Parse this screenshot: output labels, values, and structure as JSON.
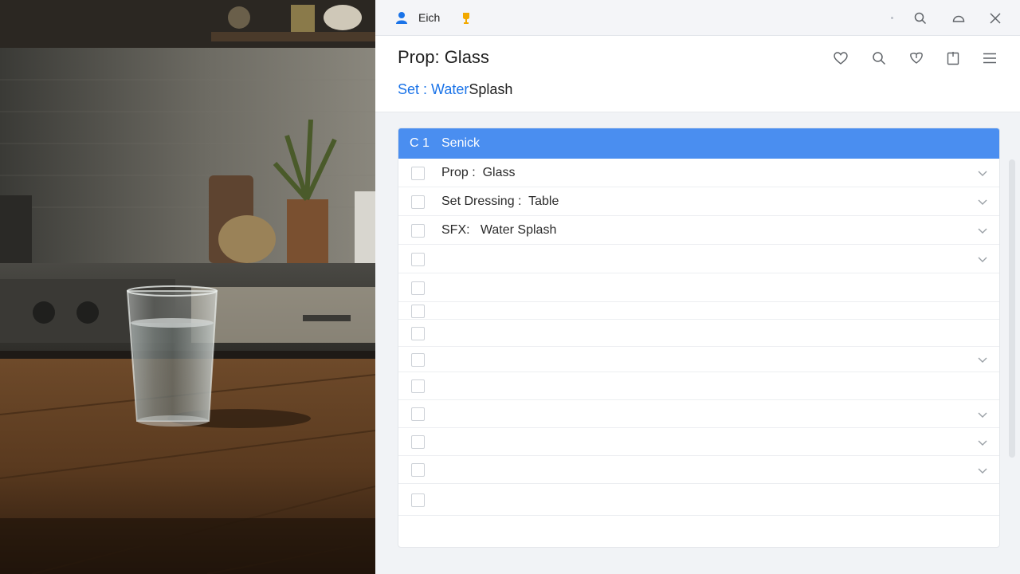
{
  "topbar": {
    "user_name": "Eich"
  },
  "header": {
    "title": "Prop: Glass",
    "subtitle_prefix": "Set :",
    "subtitle_mid": "Water",
    "subtitle_end": "Splash"
  },
  "list": {
    "header_code": "C 1",
    "header_label": "Senick",
    "rows": [
      {
        "label": "Prop :  Glass",
        "chevron": true
      },
      {
        "label": "Set Dressing :  Table",
        "chevron": true
      },
      {
        "label": "SFX:   Water Splash",
        "chevron": true
      },
      {
        "label": "",
        "chevron": true
      },
      {
        "label": "",
        "chevron": false
      },
      {
        "label": "",
        "chevron": false
      },
      {
        "label": "",
        "chevron": false
      },
      {
        "label": "",
        "chevron": true
      },
      {
        "label": "",
        "chevron": false
      },
      {
        "label": "",
        "chevron": true
      },
      {
        "label": "",
        "chevron": true
      },
      {
        "label": "",
        "chevron": true
      },
      {
        "label": "",
        "chevron": false
      }
    ]
  },
  "colors": {
    "accent": "#1a73e8",
    "list_header": "#4a8ef0",
    "user_icon": "#1a73e8",
    "bell_icon": "#f2a900"
  }
}
